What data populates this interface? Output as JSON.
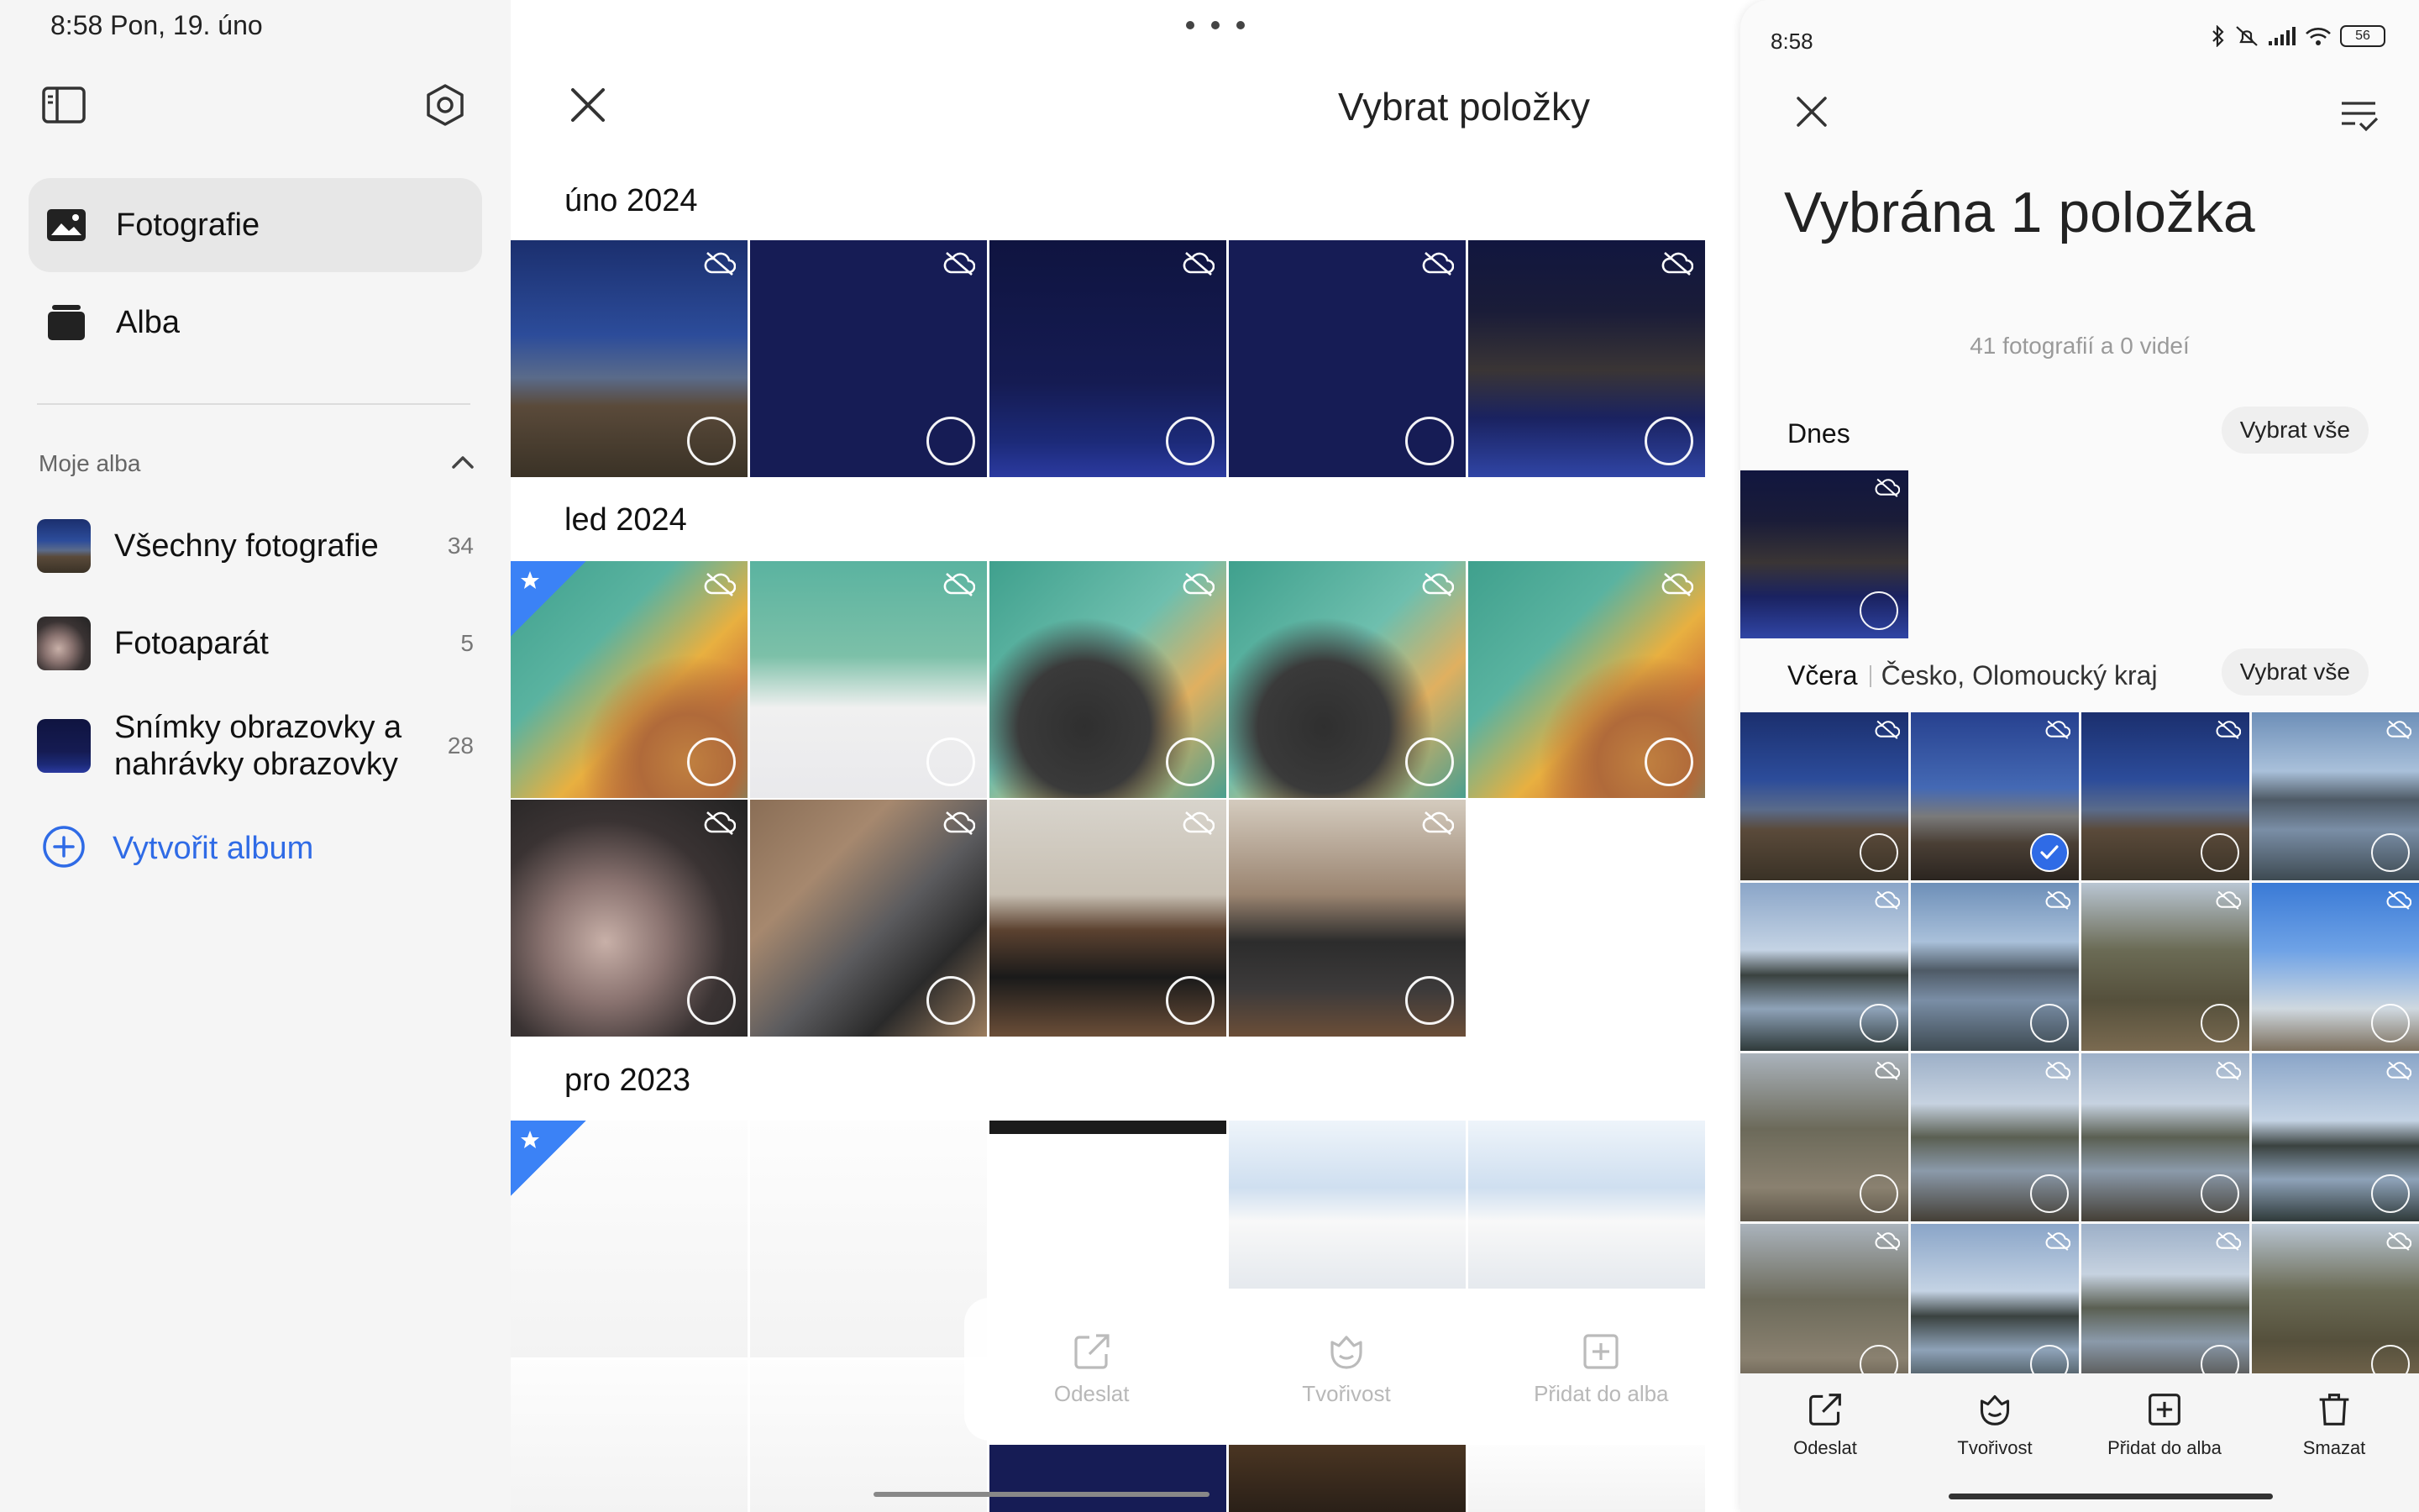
{
  "status_bar": {
    "time_date": "8:58  Pon, 19. úno"
  },
  "sidebar": {
    "nav": [
      {
        "label": "Fotografie",
        "icon": "photo-icon",
        "active": true
      },
      {
        "label": "Alba",
        "icon": "album-icon",
        "active": false
      }
    ],
    "section_label": "Moje alba",
    "albums": [
      {
        "name": "Všechny fotografie",
        "count": "34"
      },
      {
        "name": "Fotoaparát",
        "count": "5"
      },
      {
        "name": "Snímky obrazovky a nahrávky obrazovky",
        "count": "28"
      }
    ],
    "create_album": "Vytvořit album"
  },
  "middle": {
    "title": "Vybrat položky",
    "months": [
      "úno 2024",
      "led 2024",
      "pro 2023"
    ],
    "toolbar": [
      {
        "label": "Odeslat",
        "icon": "share-icon"
      },
      {
        "label": "Tvořivost",
        "icon": "creativity-icon"
      },
      {
        "label": "Přidat do alba",
        "icon": "add-to-album-icon"
      }
    ]
  },
  "right": {
    "status_time": "8:58",
    "battery": "56",
    "title": "Vybrána 1 položka",
    "subtitle": "41 fotografií a 0 videí",
    "sections": [
      {
        "label": "Dnes",
        "location": "",
        "select_all": "Vybrat vše"
      },
      {
        "label": "Včera",
        "location": "Česko, Olomoucký kraj",
        "select_all": "Vybrat vše"
      }
    ],
    "selected_count": 1,
    "toolbar": [
      {
        "label": "Odeslat",
        "icon": "share-icon"
      },
      {
        "label": "Tvořivost",
        "icon": "creativity-icon"
      },
      {
        "label": "Přidat do alba",
        "icon": "add-to-album-icon"
      },
      {
        "label": "Smazat",
        "icon": "trash-icon"
      }
    ]
  },
  "colors": {
    "accent": "#2f6be6",
    "sidebar_bg": "#f5f5f5",
    "active_nav_bg": "#e7e7e7"
  }
}
